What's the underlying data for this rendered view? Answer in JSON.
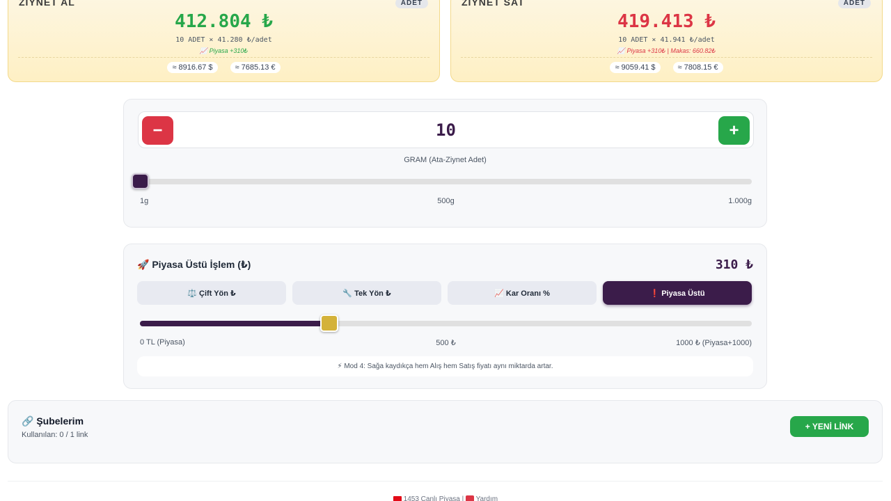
{
  "buy_card": {
    "title": "ZİYNET AL",
    "badge": "ADET",
    "price": "412.804 ₺",
    "calc": "10 ADET × 41.280 ₺/adet",
    "note": "📈 Piyasa +310₺",
    "usd": "≈ 8916.67 $",
    "eur": "≈ 7685.13 €"
  },
  "sell_card": {
    "title": "ZİYNET SAT",
    "badge": "ADET",
    "price": "419.413 ₺",
    "calc": "10 ADET × 41.941 ₺/adet",
    "note": "📈 Piyasa +310₺ | Makas: 660.82₺",
    "usd": "≈ 9059.41 $",
    "eur": "≈ 7808.15 €"
  },
  "quantity": {
    "minus_label": "−",
    "plus_label": "+",
    "value": "10",
    "caption": "GRAM (Ata-Ziynet Adet)",
    "scale_min": "1g",
    "scale_mid": "500g",
    "scale_max": "1.000g",
    "slider_fraction": 0.0
  },
  "mode": {
    "title": "🚀 Piyasa Üstü İşlem (₺)",
    "amount": "310 ₺",
    "tabs": [
      {
        "label": "⚖️ Çift Yön ₺",
        "active": false
      },
      {
        "label": "🔧 Tek Yön ₺",
        "active": false
      },
      {
        "label": "📈 Kar Oranı %",
        "active": false
      },
      {
        "label": "❗ Piyasa Üstü",
        "active": true
      }
    ],
    "slider_value": 310,
    "slider_max": 1000,
    "scale_min": "0 TL (Piyasa)",
    "scale_mid": "500 ₺",
    "scale_max": "1000 ₺ (Piyasa+1000)",
    "note": "⚡ Mod 4: Sağa kaydıkça hem Alış hem Satış fiyatı aynı miktarda artar."
  },
  "branches": {
    "title": "🔗 Şubelerim",
    "usage": "Kullanılan: 0 / 1 link",
    "new_link_label": "+ YENİ LİNK"
  },
  "footer": {
    "market": "1453 Canlı Piyasa",
    "separator": "|",
    "help": "Yardım"
  },
  "colors": {
    "accent_dark": "#3b1c4a",
    "buy_green": "#27a74a",
    "sell_red": "#dc3545",
    "gold": "#d4b23a"
  }
}
